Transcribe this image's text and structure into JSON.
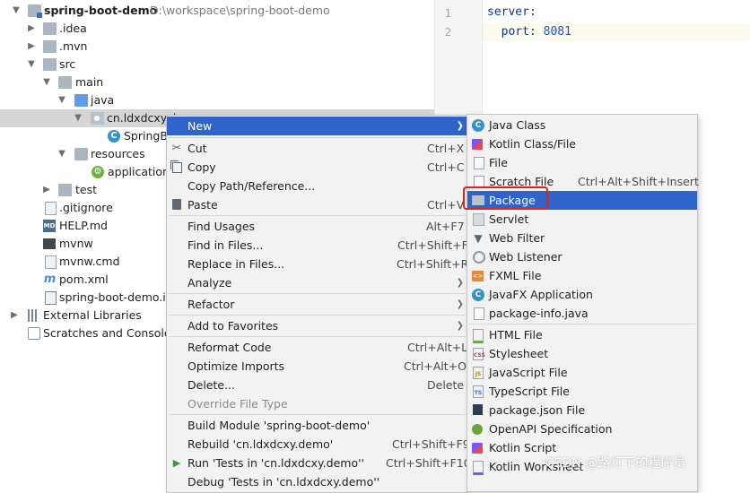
{
  "tree": {
    "rows": [
      {
        "label": "spring-boot-demo",
        "path": "D:\\workspace\\spring-boot-demo",
        "icon": "module-folder-icon",
        "expanded": true
      },
      {
        "label": ".idea",
        "icon": "folder-icon",
        "expanded": false
      },
      {
        "label": ".mvn",
        "icon": "folder-icon",
        "expanded": false
      },
      {
        "label": "src",
        "icon": "folder-icon",
        "expanded": true
      },
      {
        "label": "main",
        "icon": "folder-icon",
        "expanded": true
      },
      {
        "label": "java",
        "icon": "source-folder-icon",
        "expanded": true
      },
      {
        "label": "cn.ldxdcxy.d",
        "icon": "package-icon",
        "expanded": true
      },
      {
        "label": "SpringB",
        "icon": "spring-class-icon"
      },
      {
        "label": "resources",
        "icon": "resources-folder-icon",
        "expanded": true
      },
      {
        "label": "application",
        "icon": "properties-file-icon"
      },
      {
        "label": "test",
        "icon": "folder-icon",
        "expanded": false
      },
      {
        "label": ".gitignore",
        "icon": "gitignore-file-icon"
      },
      {
        "label": "HELP.md",
        "icon": "markdown-file-icon"
      },
      {
        "label": "mvnw",
        "icon": "shell-file-icon"
      },
      {
        "label": "mvnw.cmd",
        "icon": "text-file-icon"
      },
      {
        "label": "pom.xml",
        "icon": "maven-file-icon"
      },
      {
        "label": "spring-boot-demo.ir",
        "icon": "iml-file-icon"
      },
      {
        "label": "External Libraries",
        "icon": "libraries-icon",
        "expanded": false
      },
      {
        "label": "Scratches and Consoles",
        "icon": "scratches-icon"
      }
    ]
  },
  "editor": {
    "lines": [
      {
        "num": "1",
        "key": "server:",
        "value": ""
      },
      {
        "num": "2",
        "key": "  port:",
        "value": " 8081"
      }
    ]
  },
  "context_menu": {
    "items": [
      {
        "label": "New",
        "submenu": true,
        "highlighted": true
      },
      {
        "label": "Cut",
        "shortcut": "Ctrl+X",
        "icon": "scissors-icon"
      },
      {
        "label": "Copy",
        "shortcut": "Ctrl+C",
        "icon": "copy-icon"
      },
      {
        "label": "Copy Path/Reference...",
        "shortcut": ""
      },
      {
        "label": "Paste",
        "shortcut": "Ctrl+V",
        "icon": "paste-icon"
      },
      {
        "label": "Find Usages",
        "shortcut": "Alt+F7"
      },
      {
        "label": "Find in Files...",
        "shortcut": "Ctrl+Shift+F"
      },
      {
        "label": "Replace in Files...",
        "shortcut": "Ctrl+Shift+R"
      },
      {
        "label": "Analyze",
        "submenu": true
      },
      {
        "label": "Refactor",
        "submenu": true
      },
      {
        "label": "Add to Favorites",
        "submenu": true
      },
      {
        "label": "Reformat Code",
        "shortcut": "Ctrl+Alt+L"
      },
      {
        "label": "Optimize Imports",
        "shortcut": "Ctrl+Alt+O"
      },
      {
        "label": "Delete...",
        "shortcut": "Delete"
      },
      {
        "label": "Override File Type",
        "disabled": true
      },
      {
        "label": "Build Module 'spring-boot-demo'"
      },
      {
        "label": "Rebuild 'cn.ldxdcxy.demo'",
        "shortcut": "Ctrl+Shift+F9"
      },
      {
        "label": "Run 'Tests in 'cn.ldxdcxy.demo''",
        "shortcut": "Ctrl+Shift+F10",
        "icon": "run-icon"
      },
      {
        "label": "Debug 'Tests in 'cn.ldxdcxy.demo''"
      }
    ]
  },
  "new_submenu": {
    "items": [
      {
        "label": "Java Class",
        "icon": "java-class-icon"
      },
      {
        "label": "Kotlin Class/File",
        "icon": "kotlin-icon"
      },
      {
        "label": "File",
        "icon": "file-icon"
      },
      {
        "label": "Scratch File",
        "shortcut": "Ctrl+Alt+Shift+Insert",
        "icon": "scratch-file-icon"
      },
      {
        "label": "Package",
        "icon": "package-icon",
        "highlighted": true
      },
      {
        "label": "Servlet",
        "icon": "servlet-icon"
      },
      {
        "label": "Web Filter",
        "icon": "filter-icon"
      },
      {
        "label": "Web Listener",
        "icon": "listener-icon"
      },
      {
        "label": "FXML File",
        "icon": "fxml-icon"
      },
      {
        "label": "JavaFX Application",
        "icon": "javafx-class-icon"
      },
      {
        "label": "package-info.java",
        "icon": "package-info-icon"
      },
      {
        "label": "HTML File",
        "icon": "html-icon"
      },
      {
        "label": "Stylesheet",
        "icon": "css-icon"
      },
      {
        "label": "JavaScript File",
        "icon": "javascript-icon"
      },
      {
        "label": "TypeScript File",
        "icon": "typescript-icon"
      },
      {
        "label": "package.json File",
        "icon": "package-json-icon"
      },
      {
        "label": "OpenAPI Specification",
        "icon": "openapi-icon"
      },
      {
        "label": "Kotlin Script",
        "icon": "kotlin-script-icon"
      },
      {
        "label": "Kotlin Worksheet",
        "icon": "kotlin-worksheet-icon"
      }
    ]
  },
  "watermark": "CSDN @路灯下的程序员",
  "colors": {
    "highlight": "#2f65ca",
    "annotation": "#e2231a",
    "menu_bg": "#f2f2f2"
  }
}
